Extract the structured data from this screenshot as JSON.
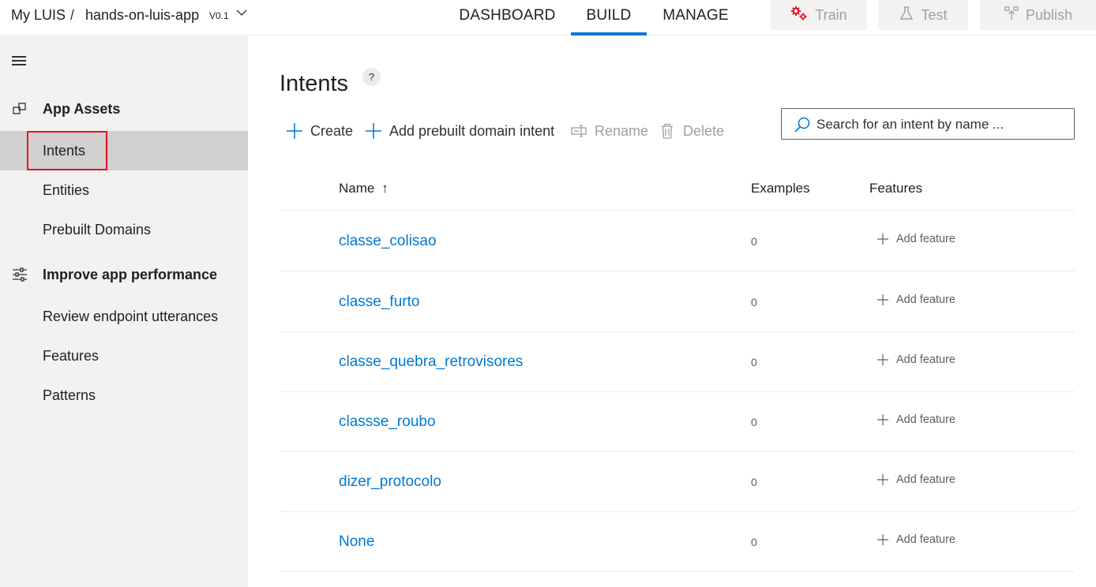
{
  "header": {
    "my_luis": "My LUIS",
    "separator": "/",
    "app_name": "hands-on-luis-app",
    "version": "V0.1",
    "tabs": [
      {
        "label": "DASHBOARD",
        "active": false
      },
      {
        "label": "BUILD",
        "active": true
      },
      {
        "label": "MANAGE",
        "active": false
      }
    ],
    "actions": {
      "train": "Train",
      "test": "Test",
      "publish": "Publish"
    }
  },
  "sidebar": {
    "groups": {
      "app_assets": "App Assets",
      "improve": "Improve app performance"
    },
    "items": {
      "intents": "Intents",
      "entities": "Entities",
      "prebuilt_domains": "Prebuilt Domains",
      "review": "Review endpoint utterances",
      "features": "Features",
      "patterns": "Patterns"
    },
    "selected": "Intents"
  },
  "main": {
    "title": "Intents",
    "help": "?",
    "commands": {
      "create": "Create",
      "add_prebuilt": "Add prebuilt domain intent",
      "rename": "Rename",
      "delete": "Delete"
    },
    "search": {
      "placeholder": "Search for an intent by name ..."
    },
    "columns": {
      "name": "Name",
      "sort_glyph": "↑",
      "examples": "Examples",
      "features": "Features"
    },
    "rows": [
      {
        "name": "classe_colisao",
        "examples": "0",
        "feature_action": "Add feature"
      },
      {
        "name": "classe_furto",
        "examples": "0",
        "feature_action": "Add feature"
      },
      {
        "name": "classe_quebra_retrovisores",
        "examples": "0",
        "feature_action": "Add feature"
      },
      {
        "name": "classse_roubo",
        "examples": "0",
        "feature_action": "Add feature"
      },
      {
        "name": "dizer_protocolo",
        "examples": "0",
        "feature_action": "Add feature"
      },
      {
        "name": "None",
        "examples": "0",
        "feature_action": "Add feature"
      }
    ]
  },
  "colors": {
    "accent": "#0078d4",
    "highlight": "#e81123",
    "train_icon": "#e81123"
  }
}
